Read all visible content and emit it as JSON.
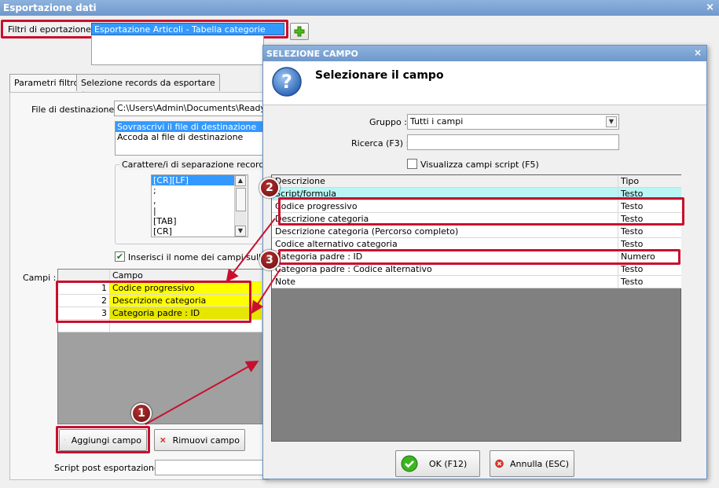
{
  "window": {
    "title": "Esportazione dati",
    "close_glyph": "×"
  },
  "export_filters": {
    "label": "Filtri di eportazione :",
    "selected": "Esportazione Articoli - Tabella categorie"
  },
  "tabs": [
    {
      "label": "Parametri filtro"
    },
    {
      "label": "Selezione records da esportare"
    }
  ],
  "destination": {
    "label": "File di destinazione :",
    "path": "C:\\Users\\Admin\\Documents\\ReadyPro",
    "options": [
      "Sovrascrivi il file di destinazione",
      "Accoda al file di destinazione"
    ]
  },
  "separator": {
    "title": "Carattere/i di separazione records",
    "items": [
      "[CR][LF]",
      ";",
      ",",
      "|",
      "[TAB]",
      "[CR]"
    ]
  },
  "insert_names": {
    "label": "Inserisci il nome dei campi sulla prima"
  },
  "fields": {
    "label": "Campi :",
    "column": "Campo",
    "rows": [
      {
        "n": "1",
        "name": "Codice progressivo"
      },
      {
        "n": "2",
        "name": "Descrizione categoria"
      },
      {
        "n": "3",
        "name": "Categoria padre : ID"
      }
    ]
  },
  "buttons": {
    "add": "Aggiungi campo",
    "remove": "Rimuovi campo"
  },
  "post_script": {
    "label": "Script post esportazione :"
  },
  "dialog": {
    "title": "SELEZIONE CAMPO",
    "close_glyph": "×",
    "heading": "Selezionare il campo",
    "group_label": "Gruppo :",
    "group_value": "Tutti i campi",
    "search_label": "Ricerca (F3) :",
    "search_value": "",
    "show_script": "Visualizza campi script (F5)",
    "columns": [
      "Descrizione",
      "Tipo"
    ],
    "rows": [
      {
        "desc": "Script/formula",
        "type": "Testo"
      },
      {
        "desc": "Codice progressivo",
        "type": "Testo"
      },
      {
        "desc": "Descrizione categoria",
        "type": "Testo"
      },
      {
        "desc": "Descrizione categoria (Percorso completo)",
        "type": "Testo"
      },
      {
        "desc": "Codice alternativo categoria",
        "type": "Testo"
      },
      {
        "desc": "Categoria padre : ID",
        "type": "Numero"
      },
      {
        "desc": "Categoria padre : Codice alternativo",
        "type": "Testo"
      },
      {
        "desc": "Note",
        "type": "Testo"
      }
    ],
    "ok": "OK (F12)",
    "cancel": "Annulla (ESC)"
  },
  "badges": [
    "1",
    "2",
    "3"
  ],
  "colors": {
    "title_bar": "#7aa3d4",
    "highlight_red": "#c8102e",
    "field_yellow": "#ffff00",
    "selection_blue": "#3399ff",
    "cyan_row": "#b9f5f5"
  }
}
